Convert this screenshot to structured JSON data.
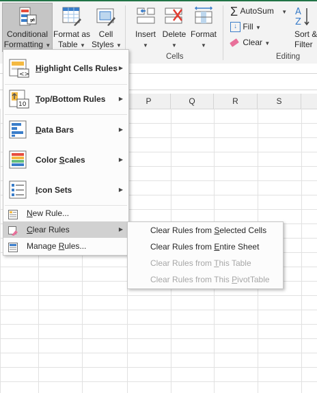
{
  "ribbon": {
    "styles_buttons": [
      {
        "id": "conditional-formatting",
        "line1": "Conditional",
        "line2": "Formatting",
        "icon": "conditional-formatting-icon"
      },
      {
        "id": "format-as-table",
        "line1": "Format as",
        "line2": "Table",
        "icon": "format-as-table-icon"
      },
      {
        "id": "cell-styles",
        "line1": "Cell",
        "line2": "Styles",
        "icon": "cell-styles-icon"
      }
    ],
    "cells_buttons": [
      {
        "id": "insert",
        "label": "Insert",
        "icon": "insert-cells-icon"
      },
      {
        "id": "delete",
        "label": "Delete",
        "icon": "delete-cells-icon"
      },
      {
        "id": "format",
        "label": "Format",
        "icon": "format-cells-icon"
      }
    ],
    "cells_group_label": "Cells",
    "editing": {
      "autosum": "AutoSum",
      "fill": "Fill",
      "clear": "Clear",
      "sort_line1": "Sort &",
      "sort_line2": "Filter",
      "group_label": "Editing"
    }
  },
  "sheet": {
    "columns": [
      "P",
      "Q",
      "R",
      "S"
    ]
  },
  "menu": {
    "items": [
      {
        "label_pre": "",
        "label_ul": "H",
        "label_post": "ighlight Cells Rules",
        "icon": "highlight-cells-rules-icon",
        "has_submenu": true
      },
      {
        "label_pre": "",
        "label_ul": "T",
        "label_post": "op/Bottom Rules",
        "icon": "top-bottom-rules-icon",
        "has_submenu": true
      },
      {
        "label_pre": "",
        "label_ul": "D",
        "label_post": "ata Bars",
        "icon": "data-bars-icon",
        "has_submenu": true
      },
      {
        "label_pre": "Color ",
        "label_ul": "S",
        "label_post": "cales",
        "icon": "color-scales-icon",
        "has_submenu": true
      },
      {
        "label_pre": "",
        "label_ul": "I",
        "label_post": "con Sets",
        "icon": "icon-sets-icon",
        "has_submenu": true
      },
      {
        "label_pre": "",
        "label_ul": "N",
        "label_post": "ew Rule...",
        "icon": "new-rule-icon",
        "has_submenu": false
      },
      {
        "label_pre": "",
        "label_ul": "C",
        "label_post": "lear Rules",
        "icon": "clear-rules-icon",
        "has_submenu": true
      },
      {
        "label_pre": "Manage ",
        "label_ul": "R",
        "label_post": "ules...",
        "icon": "manage-rules-icon",
        "has_submenu": false
      }
    ]
  },
  "submenu": {
    "items": [
      {
        "label_pre": "Clear Rules from ",
        "label_ul": "S",
        "label_post": "elected Cells",
        "enabled": true
      },
      {
        "label_pre": "Clear Rules from ",
        "label_ul": "E",
        "label_post": "ntire Sheet",
        "enabled": true
      },
      {
        "label_pre": "Clear Rules from ",
        "label_ul": "T",
        "label_post": "his Table",
        "enabled": false
      },
      {
        "label_pre": "Clear Rules from This ",
        "label_ul": "P",
        "label_post": "ivotTable",
        "enabled": false
      }
    ]
  },
  "colors": {
    "accent": "#217346",
    "hover": "#d1d1d1",
    "disabled_text": "#a6a6a6"
  }
}
